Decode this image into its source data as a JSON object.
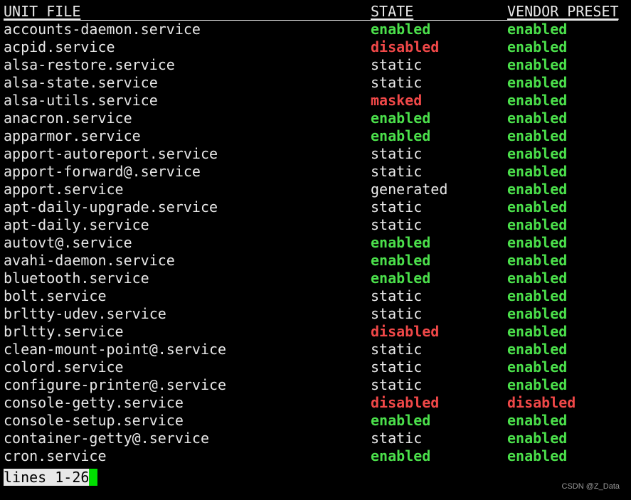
{
  "header": {
    "unit_file": "UNIT FILE",
    "state": "STATE",
    "vendor_preset": "VENDOR PRESET"
  },
  "rows": [
    {
      "unit": "accounts-daemon.service",
      "state": "enabled",
      "vendor": "enabled"
    },
    {
      "unit": "acpid.service",
      "state": "disabled",
      "vendor": "enabled"
    },
    {
      "unit": "alsa-restore.service",
      "state": "static",
      "vendor": "enabled"
    },
    {
      "unit": "alsa-state.service",
      "state": "static",
      "vendor": "enabled"
    },
    {
      "unit": "alsa-utils.service",
      "state": "masked",
      "vendor": "enabled"
    },
    {
      "unit": "anacron.service",
      "state": "enabled",
      "vendor": "enabled"
    },
    {
      "unit": "apparmor.service",
      "state": "enabled",
      "vendor": "enabled"
    },
    {
      "unit": "apport-autoreport.service",
      "state": "static",
      "vendor": "enabled"
    },
    {
      "unit": "apport-forward@.service",
      "state": "static",
      "vendor": "enabled"
    },
    {
      "unit": "apport.service",
      "state": "generated",
      "vendor": "enabled"
    },
    {
      "unit": "apt-daily-upgrade.service",
      "state": "static",
      "vendor": "enabled"
    },
    {
      "unit": "apt-daily.service",
      "state": "static",
      "vendor": "enabled"
    },
    {
      "unit": "autovt@.service",
      "state": "enabled",
      "vendor": "enabled"
    },
    {
      "unit": "avahi-daemon.service",
      "state": "enabled",
      "vendor": "enabled"
    },
    {
      "unit": "bluetooth.service",
      "state": "enabled",
      "vendor": "enabled"
    },
    {
      "unit": "bolt.service",
      "state": "static",
      "vendor": "enabled"
    },
    {
      "unit": "brltty-udev.service",
      "state": "static",
      "vendor": "enabled"
    },
    {
      "unit": "brltty.service",
      "state": "disabled",
      "vendor": "enabled"
    },
    {
      "unit": "clean-mount-point@.service",
      "state": "static",
      "vendor": "enabled"
    },
    {
      "unit": "colord.service",
      "state": "static",
      "vendor": "enabled"
    },
    {
      "unit": "configure-printer@.service",
      "state": "static",
      "vendor": "enabled"
    },
    {
      "unit": "console-getty.service",
      "state": "disabled",
      "vendor": "disabled"
    },
    {
      "unit": "console-setup.service",
      "state": "enabled",
      "vendor": "enabled"
    },
    {
      "unit": "container-getty@.service",
      "state": "static",
      "vendor": "enabled"
    },
    {
      "unit": "cron.service",
      "state": "enabled",
      "vendor": "enabled"
    }
  ],
  "pager": {
    "status": "lines 1-26"
  },
  "watermark": "CSDN @Z_Data",
  "colors": {
    "background": "#000000",
    "text": "#e8e8e8",
    "enabled": "#4be04b",
    "disabled": "#f04848",
    "cursor": "#00e000"
  }
}
